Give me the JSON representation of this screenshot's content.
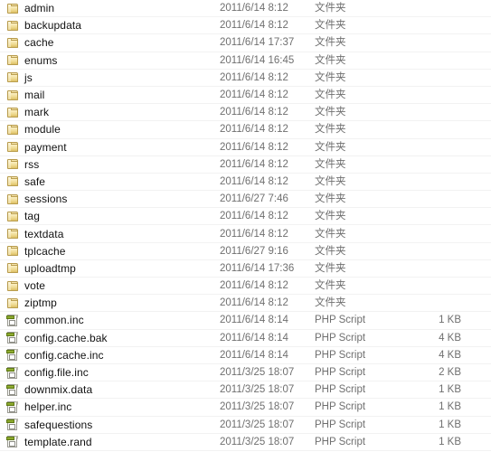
{
  "window": {
    "view": "details",
    "background_color": "#ffffff",
    "text_color": "#111111",
    "meta_text_color": "#6f6f6f"
  },
  "columns": {
    "name": "",
    "date_modified": "",
    "type": "",
    "size": ""
  },
  "rows": [
    {
      "name": "admin",
      "icon": "folder-icon",
      "date": "2011/6/14 8:12",
      "type": "文件夹",
      "size": ""
    },
    {
      "name": "backupdata",
      "icon": "folder-icon",
      "date": "2011/6/14 8:12",
      "type": "文件夹",
      "size": ""
    },
    {
      "name": "cache",
      "icon": "folder-icon",
      "date": "2011/6/14 17:37",
      "type": "文件夹",
      "size": ""
    },
    {
      "name": "enums",
      "icon": "folder-icon",
      "date": "2011/6/14 16:45",
      "type": "文件夹",
      "size": ""
    },
    {
      "name": "js",
      "icon": "folder-icon",
      "date": "2011/6/14 8:12",
      "type": "文件夹",
      "size": ""
    },
    {
      "name": "mail",
      "icon": "folder-icon",
      "date": "2011/6/14 8:12",
      "type": "文件夹",
      "size": ""
    },
    {
      "name": "mark",
      "icon": "folder-icon",
      "date": "2011/6/14 8:12",
      "type": "文件夹",
      "size": ""
    },
    {
      "name": "module",
      "icon": "folder-icon",
      "date": "2011/6/14 8:12",
      "type": "文件夹",
      "size": ""
    },
    {
      "name": "payment",
      "icon": "folder-icon",
      "date": "2011/6/14 8:12",
      "type": "文件夹",
      "size": ""
    },
    {
      "name": "rss",
      "icon": "folder-icon",
      "date": "2011/6/14 8:12",
      "type": "文件夹",
      "size": ""
    },
    {
      "name": "safe",
      "icon": "folder-icon",
      "date": "2011/6/14 8:12",
      "type": "文件夹",
      "size": ""
    },
    {
      "name": "sessions",
      "icon": "folder-icon",
      "date": "2011/6/27 7:46",
      "type": "文件夹",
      "size": ""
    },
    {
      "name": "tag",
      "icon": "folder-icon",
      "date": "2011/6/14 8:12",
      "type": "文件夹",
      "size": ""
    },
    {
      "name": "textdata",
      "icon": "folder-icon",
      "date": "2011/6/14 8:12",
      "type": "文件夹",
      "size": ""
    },
    {
      "name": "tplcache",
      "icon": "folder-icon",
      "date": "2011/6/27 9:16",
      "type": "文件夹",
      "size": ""
    },
    {
      "name": "uploadtmp",
      "icon": "folder-icon",
      "date": "2011/6/14 17:36",
      "type": "文件夹",
      "size": ""
    },
    {
      "name": "vote",
      "icon": "folder-icon",
      "date": "2011/6/14 8:12",
      "type": "文件夹",
      "size": ""
    },
    {
      "name": "ziptmp",
      "icon": "folder-icon",
      "date": "2011/6/14 8:12",
      "type": "文件夹",
      "size": ""
    },
    {
      "name": "common.inc",
      "icon": "php-icon",
      "date": "2011/6/14 8:14",
      "type": "PHP Script",
      "size": "1 KB"
    },
    {
      "name": "config.cache.bak",
      "icon": "php-icon",
      "date": "2011/6/14 8:14",
      "type": "PHP Script",
      "size": "4 KB"
    },
    {
      "name": "config.cache.inc",
      "icon": "php-icon",
      "date": "2011/6/14 8:14",
      "type": "PHP Script",
      "size": "4 KB"
    },
    {
      "name": "config.file.inc",
      "icon": "php-icon",
      "date": "2011/3/25 18:07",
      "type": "PHP Script",
      "size": "2 KB"
    },
    {
      "name": "downmix.data",
      "icon": "php-icon",
      "date": "2011/3/25 18:07",
      "type": "PHP Script",
      "size": "1 KB"
    },
    {
      "name": "helper.inc",
      "icon": "php-icon",
      "date": "2011/3/25 18:07",
      "type": "PHP Script",
      "size": "1 KB"
    },
    {
      "name": "safequestions",
      "icon": "php-icon",
      "date": "2011/3/25 18:07",
      "type": "PHP Script",
      "size": "1 KB"
    },
    {
      "name": "template.rand",
      "icon": "php-icon",
      "date": "2011/3/25 18:07",
      "type": "PHP Script",
      "size": "1 KB"
    }
  ]
}
